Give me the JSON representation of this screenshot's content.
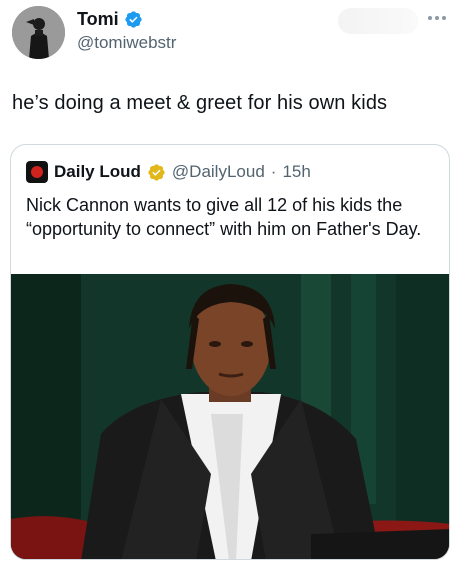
{
  "author": {
    "name": "Tomi",
    "handle": "@tomiwebstr"
  },
  "tweet": {
    "text": "he’s doing a meet & greet for his own kids"
  },
  "quoted": {
    "name": "Daily Loud",
    "handle": "@DailyLoud",
    "separator": "·",
    "time": "15h",
    "text": "Nick Cannon wants to give all 12 of his kids the “opportunity to connect” with him on Father's Day."
  },
  "colors": {
    "verified_blue": "#1d9bf0",
    "verified_gold": "#e2b719"
  }
}
